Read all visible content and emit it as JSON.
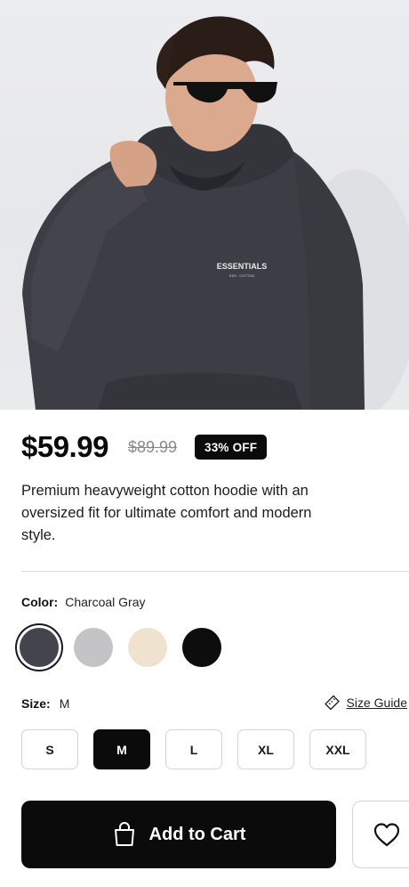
{
  "product": {
    "image_alt": "Model wearing charcoal oversized hoodie",
    "print_brand": "ESSENTIALS",
    "print_sub": "ESS · COTTON",
    "price": "$59.99",
    "original_price": "$89.99",
    "discount_badge": "33% OFF",
    "description": "Premium heavyweight cotton hoodie with an oversized fit for ultimate comfort and modern style."
  },
  "color": {
    "label": "Color:",
    "selected": "Charcoal Gray",
    "swatches": [
      {
        "name": "Charcoal Gray",
        "hex": "#44454c",
        "selected": true
      },
      {
        "name": "Light Gray",
        "hex": "#c4c4c6",
        "selected": false
      },
      {
        "name": "Cream",
        "hex": "#efe2cf",
        "selected": false
      },
      {
        "name": "Black",
        "hex": "#0d0d0d",
        "selected": false
      }
    ]
  },
  "size": {
    "label": "Size:",
    "selected": "M",
    "guide_label": "Size Guide",
    "guide_icon": "ruler-icon",
    "options": [
      "S",
      "M",
      "L",
      "XL",
      "XXL"
    ]
  },
  "actions": {
    "add_to_cart": "Add to Cart",
    "cart_icon": "shopping-bag-icon",
    "wishlist_icon": "heart-icon"
  },
  "theme": {
    "accent": "#0b0b0b",
    "muted": "#8a8a8a",
    "border": "#d5d5d5",
    "background": "#ffffff"
  }
}
